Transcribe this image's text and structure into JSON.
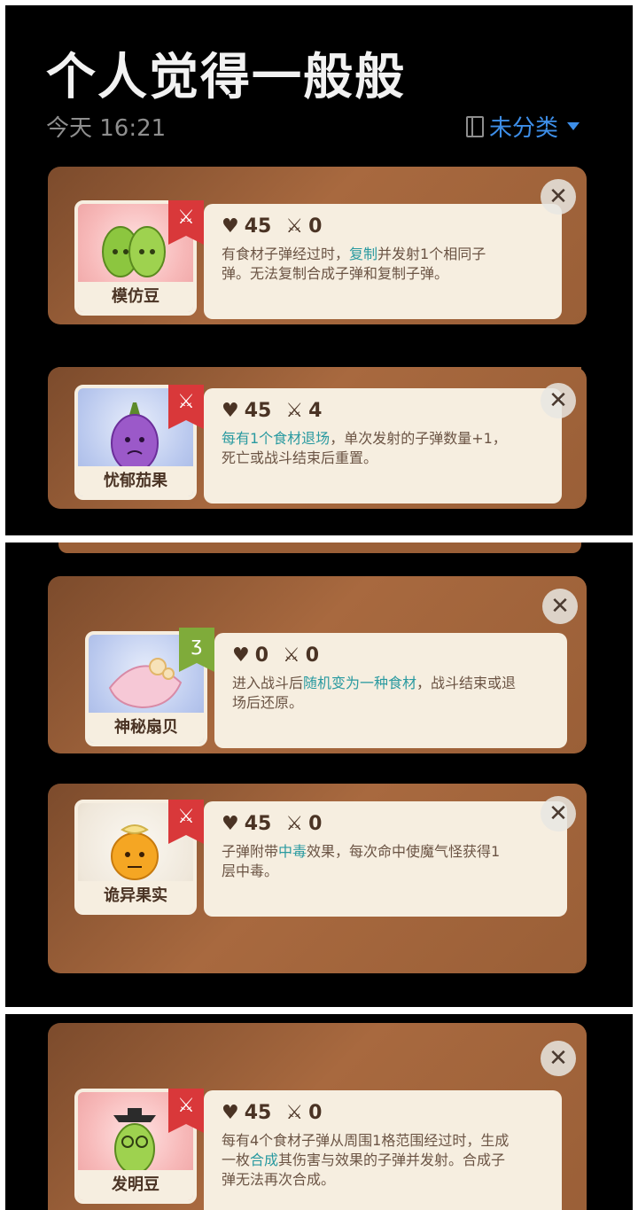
{
  "header": {
    "title": "个人觉得一般般",
    "time": "今天 16:21",
    "category": "未分类"
  },
  "icons": {
    "book": "book-icon",
    "dropdown": "triangle-down-icon",
    "close": "close-icon",
    "heart": "heart-icon",
    "swords": "crossed-swords-icon",
    "tag_red": "red-swords-flag-icon",
    "tag_green": "green-flag-icon"
  },
  "glyphs": {
    "close": "✕",
    "heart": "♥",
    "swords": "⚔",
    "flag_swords": "⚔",
    "flag_green": "ʒ"
  },
  "colors": {
    "accent": "#3d8ee8",
    "highlight": "#2a9aa0",
    "card_brown": "#a8693f",
    "flag_red": "#d9383a",
    "flag_green": "#7fab3a"
  },
  "cards": [
    {
      "name": "模仿豆",
      "hp": "45",
      "atk": "0",
      "lines": [
        [
          {
            "t": "有食材子弹经过时，"
          },
          {
            "t": "复制",
            "hl": true
          },
          {
            "t": "并发射1个相同子"
          }
        ],
        [
          {
            "t": "弹。无法复制合成子弹和复制子弹。"
          }
        ]
      ]
    },
    {
      "name": "忧郁茄果",
      "hp": "45",
      "atk": "4",
      "lines": [
        [
          {
            "t": "每有1个食材退场",
            "hl": true
          },
          {
            "t": "，单次发射的子弹数量+1，"
          }
        ],
        [
          {
            "t": "死亡或战斗结束后重置。"
          }
        ]
      ]
    },
    {
      "name": "神秘扇贝",
      "hp": "0",
      "atk": "0",
      "lines": [
        [
          {
            "t": "进入战斗后"
          },
          {
            "t": "随机变为一种食材",
            "hl": true
          },
          {
            "t": "，战斗结束或退"
          }
        ],
        [
          {
            "t": "场后还原。"
          }
        ]
      ]
    },
    {
      "name": "诡异果实",
      "hp": "45",
      "atk": "0",
      "lines": [
        [
          {
            "t": "子弹附带"
          },
          {
            "t": "中毒",
            "hl": true
          },
          {
            "t": "效果，每次命中使魔气怪获得1"
          }
        ],
        [
          {
            "t": "层中毒。"
          }
        ]
      ]
    },
    {
      "name": "发明豆",
      "hp": "45",
      "atk": "0",
      "lines": [
        [
          {
            "t": "每有4个食材子弹从周围1格范围经过时，生成"
          }
        ],
        [
          {
            "t": "一枚"
          },
          {
            "t": "合成",
            "hl": true
          },
          {
            "t": "其伤害与效果的子弹并发射。合成子"
          }
        ],
        [
          {
            "t": "弹无法再次合成。"
          }
        ]
      ]
    }
  ]
}
